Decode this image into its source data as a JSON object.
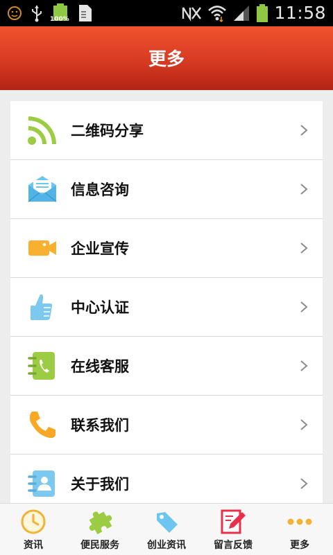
{
  "status_bar": {
    "time": "11:58",
    "battery_text": "100%"
  },
  "header": {
    "title": "更多"
  },
  "menu": {
    "items": [
      {
        "label": "二维码分享",
        "icon": "rss-icon"
      },
      {
        "label": "信息咨询",
        "icon": "envelope-icon"
      },
      {
        "label": "企业宣传",
        "icon": "video-camera-icon"
      },
      {
        "label": "中心认证",
        "icon": "thumbs-up-icon"
      },
      {
        "label": "在线客服",
        "icon": "phone-book-icon"
      },
      {
        "label": "联系我们",
        "icon": "phone-icon"
      },
      {
        "label": "关于我们",
        "icon": "contact-card-icon"
      }
    ]
  },
  "bottom_nav": {
    "items": [
      {
        "label": "资讯",
        "icon": "clock-icon"
      },
      {
        "label": "便民服务",
        "icon": "puzzle-icon"
      },
      {
        "label": "创业资讯",
        "icon": "tag-icon"
      },
      {
        "label": "留言反馈",
        "icon": "edit-icon"
      },
      {
        "label": "更多",
        "icon": "more-dots-icon"
      }
    ]
  },
  "colors": {
    "header_top": "#f1532f",
    "header_bottom": "#b32414",
    "rss_green": "#9ccc44",
    "envelope_blue": "#6cc6f0",
    "camera_orange": "#f9b030",
    "thumb_blue": "#7cc8ee",
    "phone_orange": "#f9a825"
  }
}
